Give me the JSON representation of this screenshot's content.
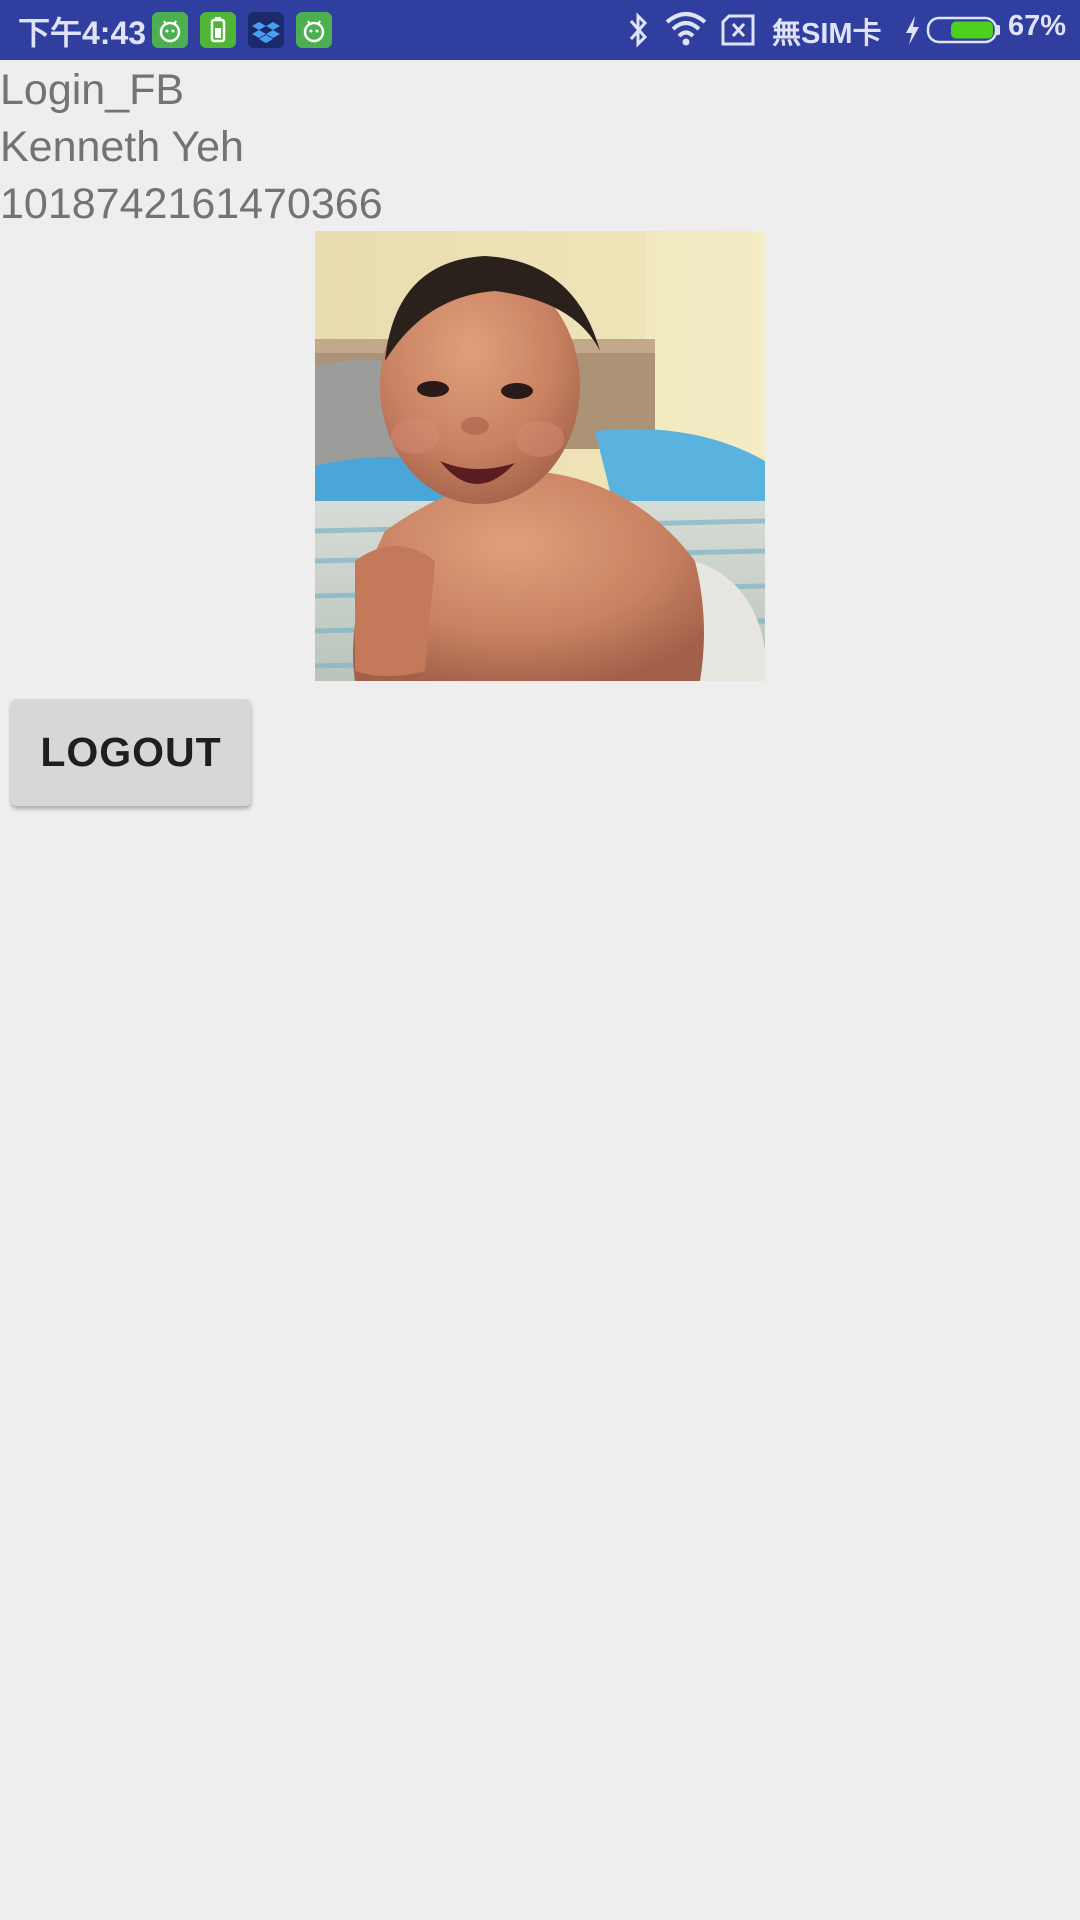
{
  "status_bar": {
    "time": "下午4:43",
    "notification_icons": [
      "android-icon",
      "battery-app-icon",
      "dropbox-icon",
      "android-icon"
    ],
    "sim_status": "無SIM卡",
    "battery_percent": "67%",
    "battery_level": 0.67,
    "background_color": "#303f9f"
  },
  "main": {
    "app_name": "Login_FB",
    "user_name": "Kenneth Yeh",
    "user_id": "1018742161470366",
    "profile_photo_icon": "profile-photo",
    "logout_label": "LOGOUT"
  }
}
